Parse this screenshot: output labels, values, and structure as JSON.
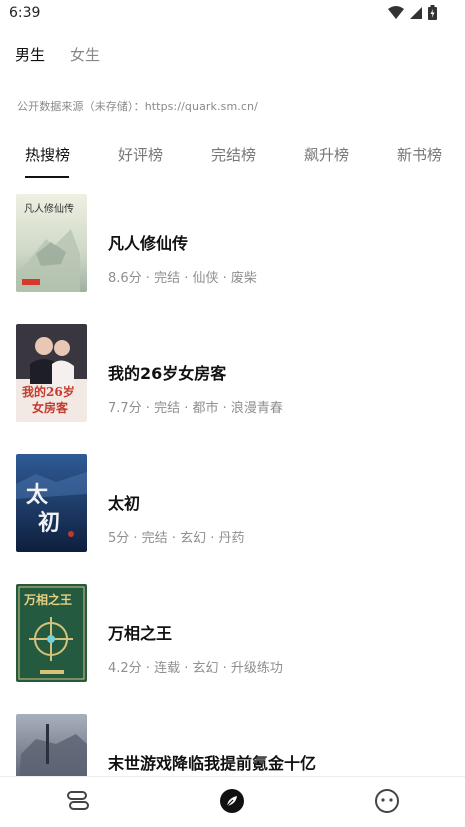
{
  "status": {
    "time": "6:39",
    "icons": [
      "wifi-icon",
      "signal-icon",
      "battery-icon"
    ]
  },
  "gender_tabs": [
    {
      "label": "男生",
      "active": true
    },
    {
      "label": "女生",
      "active": false
    }
  ],
  "source_note": "公开数据来源（未存储）：https://quark.sm.cn/",
  "rank_tabs": [
    {
      "label": "热搜榜",
      "active": true
    },
    {
      "label": "好评榜",
      "active": false
    },
    {
      "label": "完结榜",
      "active": false
    },
    {
      "label": "飙升榜",
      "active": false
    },
    {
      "label": "新书榜",
      "active": false
    }
  ],
  "books": [
    {
      "title": "凡人修仙传",
      "meta": "8.6分 · 完结 · 仙侠 · 废柴",
      "cover_text": "凡人修仙传",
      "cover_colors": [
        "#cfd8c8",
        "#e9ecd9",
        "#9fb0a0"
      ]
    },
    {
      "title": "我的26岁女房客",
      "meta": "7.7分 · 完结 · 都市 · 浪漫青春",
      "cover_text": "我的26岁女房客",
      "cover_colors": [
        "#2a2a34",
        "#f2e8e4",
        "#c63a2c"
      ]
    },
    {
      "title": "太初",
      "meta": "5分 · 完结 · 玄幻 · 丹药",
      "cover_text": "太初",
      "cover_colors": [
        "#1b3a6b",
        "#2f5b96",
        "#0e1f3d"
      ]
    },
    {
      "title": "万相之王",
      "meta": "4.2分 · 连载 · 玄幻 · 升级练功",
      "cover_text": "万相之王",
      "cover_colors": [
        "#1f4a35",
        "#2e6b4c",
        "#d8c27a"
      ]
    },
    {
      "title": "末世游戏降临我提前氪金十亿",
      "meta": "",
      "cover_text": "",
      "cover_colors": [
        "#3b4150",
        "#6c7486",
        "#a9b0bd"
      ]
    }
  ],
  "bottom_nav": [
    {
      "name": "bookshelf-icon",
      "active": false
    },
    {
      "name": "compass-icon",
      "active": true
    },
    {
      "name": "smiley-icon",
      "active": false
    }
  ]
}
